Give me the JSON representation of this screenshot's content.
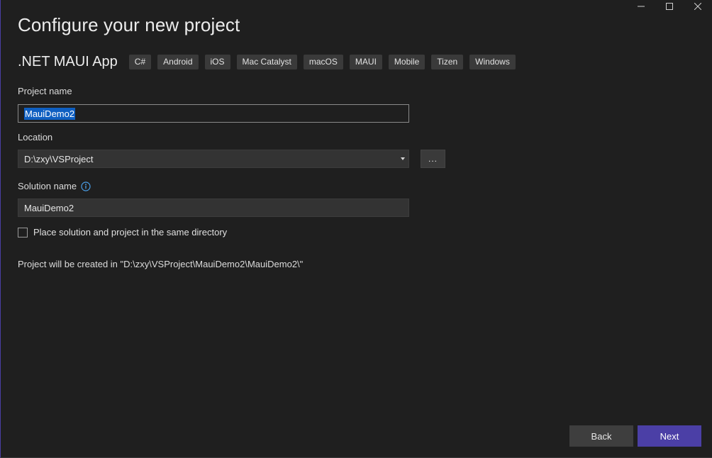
{
  "window": {
    "controls": [
      "minimize-icon",
      "maximize-icon",
      "close-icon"
    ]
  },
  "page": {
    "title": "Configure your new project"
  },
  "template": {
    "name": ".NET MAUI App",
    "tags": [
      "C#",
      "Android",
      "iOS",
      "Mac Catalyst",
      "macOS",
      "MAUI",
      "Mobile",
      "Tizen",
      "Windows"
    ]
  },
  "project_name": {
    "label": "Project name",
    "value": "MauiDemo2"
  },
  "location": {
    "label": "Location",
    "value": "D:\\zxy\\VSProject",
    "browse_label": "..."
  },
  "solution_name": {
    "label": "Solution name",
    "value": "MauiDemo2"
  },
  "same_directory": {
    "label": "Place solution and project in the same directory",
    "checked": false
  },
  "path_note": "Project will be created in \"D:\\zxy\\VSProject\\MauiDemo2\\MauiDemo2\\\"",
  "footer": {
    "back_label": "Back",
    "next_label": "Next"
  },
  "colors": {
    "background": "#1f1f1f",
    "accent": "#4b3fa6",
    "selection": "#0f5fc1"
  }
}
